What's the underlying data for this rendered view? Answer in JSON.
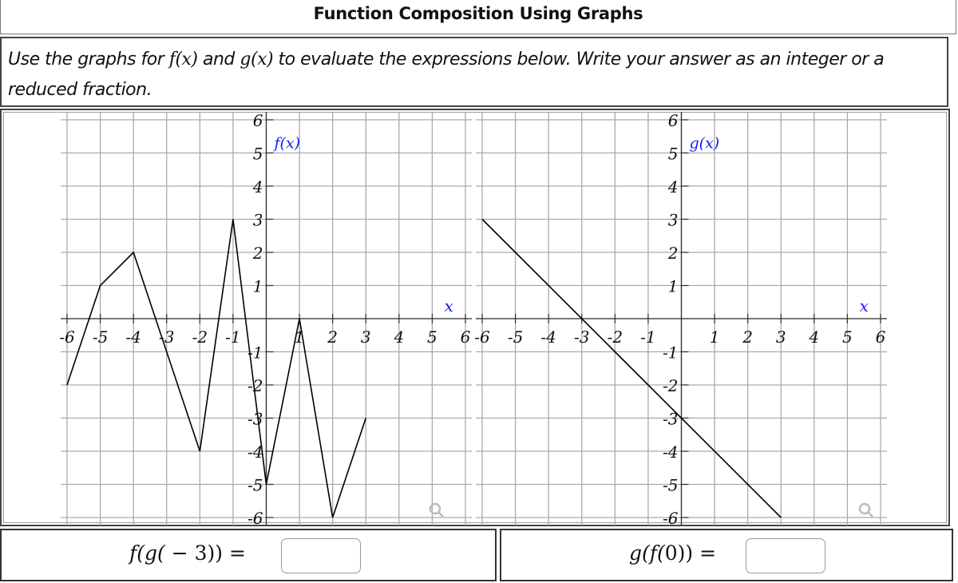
{
  "header": {
    "title": "Function Composition Using Graphs"
  },
  "instructions": {
    "part1": "Use the graphs for ",
    "f_name": "f(x)",
    "part2": " and ",
    "g_name": "g(x)",
    "part3": " to evaluate the expressions below. Write your answer as an integer or a reduced fraction."
  },
  "chart_data": [
    {
      "type": "line",
      "title": "f(x)",
      "xlabel": "x",
      "ylabel": "f(x)",
      "xlim": [
        -6,
        6
      ],
      "ylim": [
        -6,
        6
      ],
      "grid": true,
      "x_ticks": [
        -6,
        -5,
        -4,
        -3,
        -2,
        -1,
        1,
        2,
        3,
        4,
        5,
        6
      ],
      "y_ticks": [
        -6,
        -5,
        -4,
        -3,
        -2,
        -1,
        1,
        2,
        3,
        4,
        5,
        6
      ],
      "x": [
        -6,
        -5,
        -4,
        -2,
        -1,
        0,
        1,
        2,
        3
      ],
      "y": [
        -2,
        1,
        2,
        -4,
        3,
        -5,
        0,
        -6,
        -3
      ]
    },
    {
      "type": "line",
      "title": "g(x)",
      "xlabel": "x",
      "ylabel": "g(x)",
      "xlim": [
        -6,
        6
      ],
      "ylim": [
        -6,
        6
      ],
      "grid": true,
      "x_ticks": [
        -6,
        -5,
        -4,
        -3,
        -2,
        -1,
        1,
        2,
        3,
        4,
        5,
        6
      ],
      "y_ticks": [
        -6,
        -5,
        -4,
        -3,
        -2,
        -1,
        1,
        2,
        3,
        4,
        5,
        6
      ],
      "x": [
        -6,
        3
      ],
      "y": [
        3,
        -6
      ]
    }
  ],
  "colors": {
    "axis_label": "#1a1aff",
    "grid": "#aaaaaa",
    "curve": "#000000",
    "zoom_icon": "#bbbbbb"
  },
  "questions": [
    {
      "expression_prefix": "f(g(",
      "expression_arg": " − 3",
      "expression_suffix": ")) =",
      "answer": ""
    },
    {
      "expression_prefix": "g(f(",
      "expression_arg": "0",
      "expression_suffix": ")) =",
      "answer": ""
    }
  ],
  "icons": {
    "zoom": "magnifier-icon"
  }
}
